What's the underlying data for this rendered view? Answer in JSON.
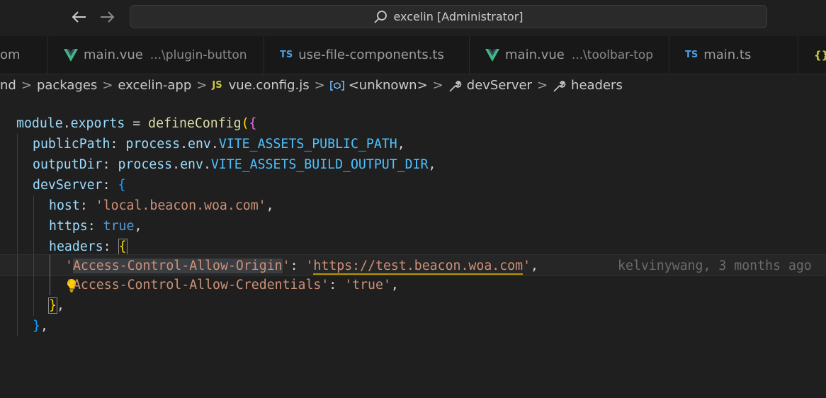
{
  "titlebar": {
    "command_center": "excelin [Administrator]"
  },
  "tabs": [
    {
      "icon": "partial",
      "label": "om",
      "desc": ""
    },
    {
      "icon": "vue",
      "label": "main.vue",
      "desc": "...\\plugin-button"
    },
    {
      "icon": "ts",
      "label": "use-file-components.ts",
      "desc": ""
    },
    {
      "icon": "vue",
      "label": "main.vue",
      "desc": "...\\toolbar-top"
    },
    {
      "icon": "ts",
      "label": "main.ts",
      "desc": ""
    },
    {
      "icon": "json",
      "label": "",
      "desc": ""
    }
  ],
  "badges": {
    "ts": "TS",
    "js": "JS",
    "json": "{}"
  },
  "breadcrumb": {
    "items": [
      "nd",
      "packages",
      "excelin-app",
      "vue.config.js",
      "<unknown>",
      "devServer",
      "headers"
    ],
    "sep": ">"
  },
  "code": {
    "l1": [
      "module",
      ".",
      "exports",
      " = ",
      "defineConfig",
      "(",
      "{"
    ],
    "l2": [
      "publicPath",
      ": ",
      "process",
      ".",
      "env",
      ".",
      "VITE_ASSETS_PUBLIC_PATH",
      ","
    ],
    "l3": [
      "outputDir",
      ": ",
      "process",
      ".",
      "env",
      ".",
      "VITE_ASSETS_BUILD_OUTPUT_DIR",
      ","
    ],
    "l4": [
      "devServer",
      ": ",
      "{"
    ],
    "l5": [
      "host",
      ": ",
      "'local.beacon.woa.com'",
      ","
    ],
    "l6": [
      "https",
      ": ",
      "true",
      ","
    ],
    "l7": [
      "headers",
      ": ",
      "{"
    ],
    "l8": [
      "'",
      "Access-Control-Allow-Origin",
      "'",
      ": ",
      "'",
      "https://test.beacon.woa.com",
      "'",
      ","
    ],
    "l9": [
      "'Access-Control-Allow-Credentials'",
      ": ",
      "'true'",
      ","
    ],
    "l10": [
      "}",
      ","
    ],
    "l11": [
      "}",
      ","
    ]
  },
  "blame": "kelvinywang, 3 months ago"
}
